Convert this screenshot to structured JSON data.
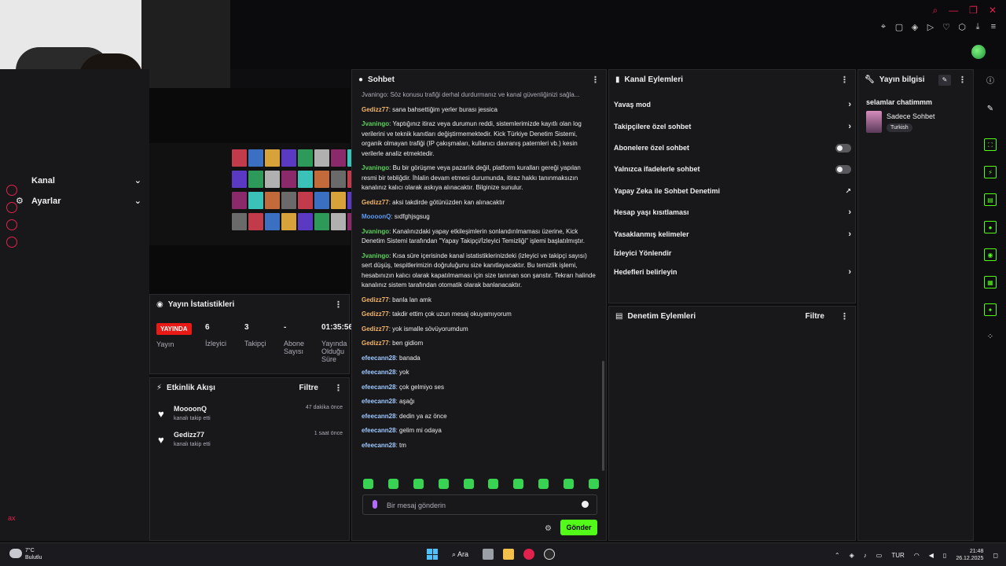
{
  "sidebar": {
    "items": [
      {
        "label": "Kanal"
      },
      {
        "label": "Ayarlar"
      }
    ],
    "bottom_text": "ax"
  },
  "stats": {
    "title": "Yayın İstatistikleri",
    "live_badge": "YAYINDA",
    "items": [
      {
        "value": "",
        "label": "Yayın"
      },
      {
        "value": "6",
        "label": "İzleyici"
      },
      {
        "value": "3",
        "label": "Takipçi"
      },
      {
        "value": "-",
        "label": "Abone Sayısı"
      },
      {
        "value": "01:35:56",
        "label": "Yayında Olduğu Süre"
      }
    ]
  },
  "activity": {
    "title": "Etkinlik Akışı",
    "filter": "Filtre",
    "items": [
      {
        "name": "MoooonQ",
        "sub": "kanalı takip etti",
        "time": "47 dakika önce"
      },
      {
        "name": "Gedizz77",
        "sub": "kanalı takip etti",
        "time": "1 saat önce"
      }
    ]
  },
  "chat": {
    "title": "Sohbet",
    "system_line": "Jvaningo: Söz konusu trafiği derhal durdurmanız ve kanal güvenliğinizi sağla...",
    "messages": [
      {
        "user": "Gedizz77",
        "cls": "u-gedizz",
        "text": "sana bahsettiğim yerler burası jessica"
      },
      {
        "user": "Jvaningo",
        "cls": "u-jvaningo",
        "text": "Yaptığınız itiraz veya durumun reddi, sistemlerimizde kayıtlı olan log verilerini ve teknik kanıtları değiştirmemektedir. Kick Türkiye Denetim Sistemi, organik olmayan trafiği (IP çakışmaları, kullanıcı davranış paternleri vb.) kesin verilerle analiz etmektedir."
      },
      {
        "user": "Jvaningo",
        "cls": "u-jvaningo",
        "text": "Bu bir görüşme veya pazarlık değil, platform kuralları gereği yapılan resmi bir tebliğdir. İhlalin devam etmesi durumunda, itiraz hakkı tanınmaksızın kanalınız kalıcı olarak askıya alınacaktır. Bilginize sunulur."
      },
      {
        "user": "Gedizz77",
        "cls": "u-gedizz",
        "text": "aksi takdirde götünüzden kan alınacaktır"
      },
      {
        "user": "MoooonQ",
        "cls": "u-mooon",
        "text": "sıdfghjsgsug"
      },
      {
        "user": "Jvaningo",
        "cls": "u-jvaningo",
        "text": "Kanalınızdaki yapay etkileşimlerin sonlandırılmaması üzerine, Kick Denetim Sistemi tarafından \"Yapay Takipçi/İzleyici Temizliği\" işlemi başlatılmıştır."
      },
      {
        "user": "Jvaningo",
        "cls": "u-jvaningo",
        "text": "Kısa süre içerisinde kanal istatistiklerinizdeki (izleyici ve takipçi sayısı) sert düşüş, tespitlerimizin doğruluğunu size kanıtlayacaktır. Bu temizlik işlemi, hesabınızın kalıcı olarak kapatılmaması için size tanınan son şanstır. Tekrarı halinde kanalınız sistem tarafından otomatik olarak banlanacaktır."
      },
      {
        "user": "Gedizz77",
        "cls": "u-gedizz",
        "text": "banla lan amk"
      },
      {
        "user": "Gedizz77",
        "cls": "u-gedizz",
        "text": "takdir ettim çok uzun mesaj okuyamıyorum"
      },
      {
        "user": "Gedizz77",
        "cls": "u-gedizz",
        "text": "yok ismalle sövüyorumdum"
      },
      {
        "user": "Gedizz77",
        "cls": "u-gedizz",
        "text": "ben gidiom"
      },
      {
        "user": "efeecann28",
        "cls": "u-efe",
        "text": "banada"
      },
      {
        "user": "efeecann28",
        "cls": "u-efe",
        "text": "yok"
      },
      {
        "user": "efeecann28",
        "cls": "u-efe",
        "text": "çok gelmiyo ses"
      },
      {
        "user": "efeecann28",
        "cls": "u-efe",
        "text": "aşağı"
      },
      {
        "user": "efeecann28",
        "cls": "u-efe",
        "text": "dedin ya az önce"
      },
      {
        "user": "efeecann28",
        "cls": "u-efe",
        "text": "gelim mi odaya"
      },
      {
        "user": "efeecann28",
        "cls": "u-efe",
        "text": "tm"
      }
    ],
    "input_placeholder": "Bir mesaj gönderin",
    "send_label": "Gönder"
  },
  "channel_actions": {
    "title": "Kanal Eylemleri",
    "rows": [
      {
        "label": "Yavaş mod",
        "control": "chevron"
      },
      {
        "label": "Takipçilere özel sohbet",
        "control": "chevron"
      },
      {
        "label": "Abonelere özel sohbet",
        "control": "toggle"
      },
      {
        "label": "Yalnızca ifadelerle sohbet",
        "control": "toggle"
      },
      {
        "label": "Yapay Zeka ile Sohbet Denetimi",
        "control": "external"
      },
      {
        "label": "Hesap yaşı kısıtlaması",
        "control": "chevron"
      },
      {
        "label": "Yasaklanmış kelimeler",
        "control": "chevron"
      },
      {
        "label": "İzleyici Yönlendir",
        "control": "none"
      },
      {
        "label": "Hedefleri belirleyin",
        "control": "chevron"
      }
    ]
  },
  "moderation": {
    "title": "Denetim Eylemleri",
    "filter": "Filtre"
  },
  "stream_info": {
    "title": "Yayın bilgisi",
    "stream_title": "selamlar chatimmm",
    "category": "Sadece Sohbet",
    "tag": "Turkish"
  },
  "taskbar": {
    "temperature": "7°C",
    "weather": "Bulutlu",
    "search": "Ara",
    "language": "TUR",
    "time": "21:48",
    "date": "26.12.2025"
  },
  "colors": {
    "accent": "#53fc18",
    "live": "#e91916",
    "panel": "#18181b",
    "background": "#0e0e10"
  }
}
